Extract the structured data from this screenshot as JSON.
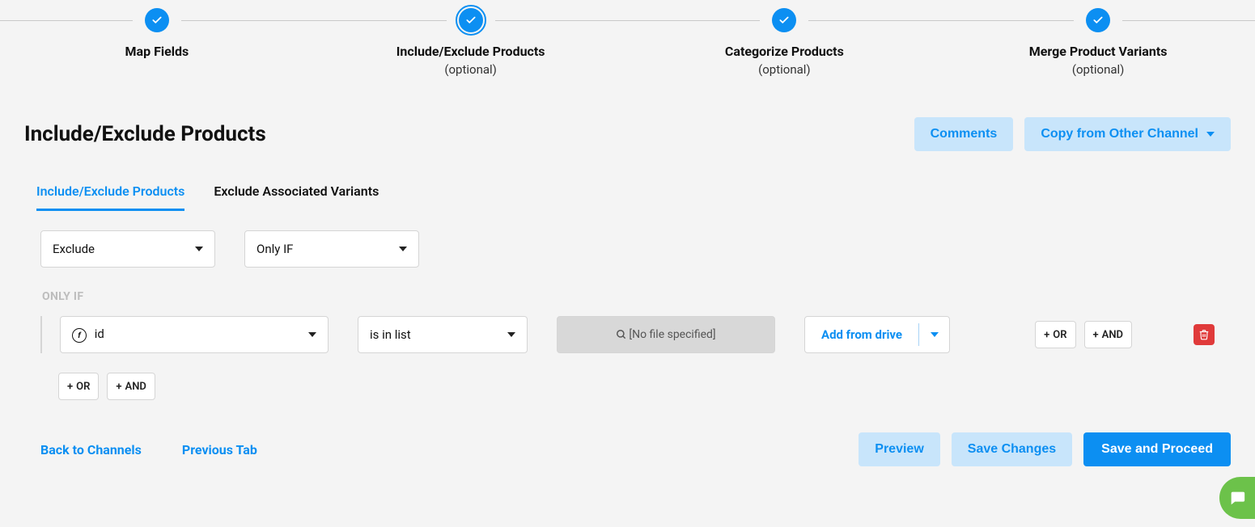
{
  "stepper": {
    "steps": [
      {
        "label": "Map Fields",
        "sub": ""
      },
      {
        "label": "Include/Exclude Products",
        "sub": "(optional)"
      },
      {
        "label": "Categorize Products",
        "sub": "(optional)"
      },
      {
        "label": "Merge Product Variants",
        "sub": "(optional)"
      }
    ]
  },
  "page_title": "Include/Exclude Products",
  "header_actions": {
    "comments": "Comments",
    "copy_from": "Copy from Other Channel"
  },
  "tabs": {
    "t0": "Include/Exclude Products",
    "t1": "Exclude Associated Variants"
  },
  "rule": {
    "action_select": "Exclude",
    "match_select": "Only IF",
    "only_if_label": "ONLY IF",
    "field": "id",
    "operator": "is in list",
    "file_placeholder": "[No file specified]",
    "drive_label": "Add from drive",
    "or": "OR",
    "and": "AND"
  },
  "footer": {
    "back": "Back to Channels",
    "prev": "Previous Tab",
    "preview": "Preview",
    "save": "Save Changes",
    "proceed": "Save and Proceed"
  }
}
